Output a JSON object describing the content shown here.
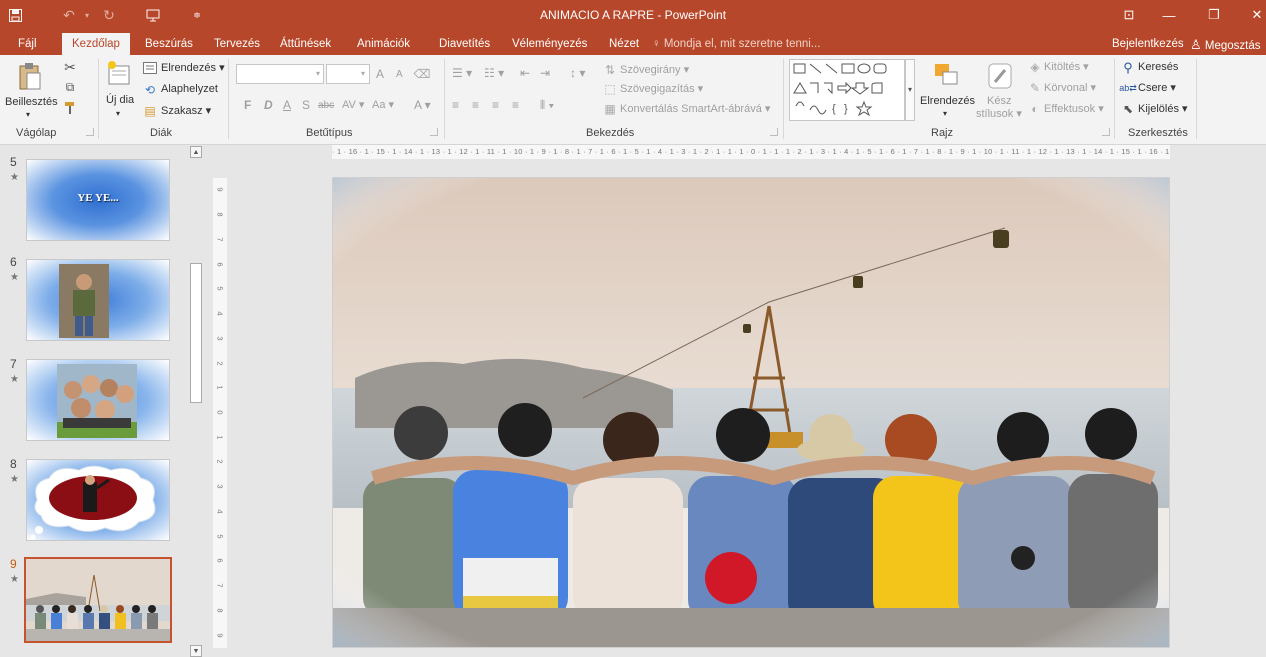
{
  "window": {
    "title": "ANIMACIO A RAPRE - PowerPoint",
    "controls": {
      "ribbon_display": "⊡",
      "minimize": "—",
      "restore": "❐",
      "close": "✕"
    }
  },
  "tabs": [
    "Fájl",
    "Kezdőlap",
    "Beszúrás",
    "Tervezés",
    "Áttűnések",
    "Animációk",
    "Diavetítés",
    "Véleményezés",
    "Nézet"
  ],
  "active_tab": "Kezdőlap",
  "tell_me": "Mondja el, mit szeretne tenni...",
  "account": {
    "signin": "Bejelentkezés",
    "share": "Megosztás"
  },
  "ribbon": {
    "clipboard": {
      "paste": "Beillesztés",
      "group": "Vágólap"
    },
    "slides": {
      "new_slide_1": "Új",
      "new_slide_2": "dia",
      "layout": "Elrendezés",
      "reset": "Alaphelyzet",
      "section": "Szakasz",
      "group": "Diák"
    },
    "font": {
      "bold": "F",
      "italic": "D",
      "underline": "A",
      "shadow": "S",
      "strike": "abc",
      "spacing": "AV",
      "case": "Aa",
      "color": "A",
      "grow": "A",
      "shrink": "A",
      "group": "Betűtípus"
    },
    "paragraph": {
      "text_direction": "Szövegirány",
      "align_text": "Szövegigazítás",
      "smartart": "Konvertálás SmartArt-ábrává",
      "group": "Bekezdés"
    },
    "drawing": {
      "arrange": "Elrendezés",
      "styles_1": "Kész",
      "styles_2": "stílusok",
      "fill": "Kitöltés",
      "outline": "Körvonal",
      "effects": "Effektusok",
      "group": "Rajz"
    },
    "editing": {
      "find": "Keresés",
      "replace": "Csere",
      "select": "Kijelölés",
      "group": "Szerkesztés"
    }
  },
  "thumbnails": [
    {
      "number": "5",
      "caption": "YE YE..."
    },
    {
      "number": "6"
    },
    {
      "number": "7"
    },
    {
      "number": "8"
    },
    {
      "number": "9",
      "selected": true
    }
  ],
  "ruler": {
    "horizontal": "· 1 · 16 · 1 · 15 · 1 · 14 · 1 · 13 · 1 · 12 · 1 · 11 · 1 · 10 · 1 · 9 · 1 · 8 · 1 · 7 · 1 · 6 · 1 · 5 · 1 · 4 · 1 · 3 · 1 · 2 · 1 · 1 · 1 · 0 · 1 · 1 · 1 · 2 · 1 · 3 · 1 · 4 · 1 · 5 · 1 · 6 · 1 · 7 · 1 · 8 · 1 · 9 · 1 · 10 · 1 · 11 · 1 · 12 · 1 · 13 · 1 · 14 · 1 · 15 · 1 · 16 · 1 ·",
    "vertical": [
      "9",
      "8",
      "7",
      "6",
      "5",
      "4",
      "3",
      "2",
      "1",
      "0",
      "1",
      "2",
      "3",
      "4",
      "5",
      "6",
      "7",
      "8",
      "9"
    ]
  },
  "colors": {
    "accent": "#b7472a",
    "selection": "#c5532f",
    "ribbon_bg": "#f3f3f3",
    "pane_bg": "#e6e6e6"
  }
}
